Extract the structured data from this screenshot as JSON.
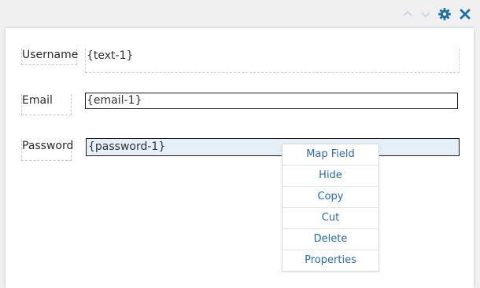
{
  "toolbar": {
    "icons": [
      "chevron-up-icon",
      "chevron-down-icon",
      "gear-icon",
      "close-icon"
    ],
    "accent_color": "#1a6fa8",
    "disabled_color": "#c9d6e2"
  },
  "form": {
    "fields": [
      {
        "label": "Username",
        "value": "{text-1}"
      },
      {
        "label": "Email",
        "value": "{email-1}"
      },
      {
        "label": "Password",
        "value": "{password-1}"
      }
    ]
  },
  "context_menu": {
    "items": [
      {
        "label": "Map Field"
      },
      {
        "label": "Hide"
      },
      {
        "label": "Copy"
      },
      {
        "label": "Cut"
      },
      {
        "label": "Delete"
      },
      {
        "label": "Properties"
      }
    ]
  }
}
